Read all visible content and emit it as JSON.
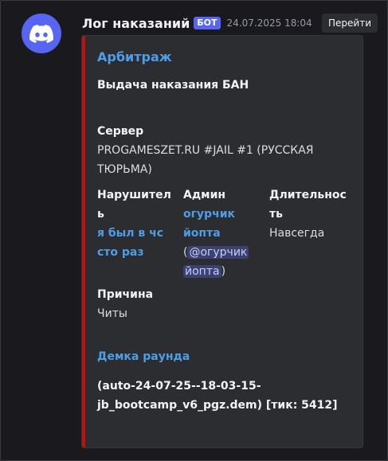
{
  "message": {
    "author": "Лог наказаний",
    "bot_tag": "БОТ",
    "timestamp": "24.07.2025 18:04",
    "go_button": "Перейти"
  },
  "embed": {
    "accent_color": "#c70c0c",
    "author": "Арбитраж",
    "title": "Выдача наказания БАН",
    "server_label": "Сервер",
    "server_line1": "PROGAMESZET.RU #JAIL #1 (РУССКАЯ",
    "server_line2": "ТЮРЬМА)",
    "offender_label_1": "Нарушител",
    "offender_label_2": "ь",
    "offender_line1": "я был в чс",
    "offender_line2": "сто раз",
    "admin_label": "Админ",
    "admin_line1": "огурчик",
    "admin_line2": "йопта",
    "admin_mention_1": "@огурчик",
    "admin_mention_2": "йопта",
    "duration_label_1": "Длительнос",
    "duration_label_2": "ть",
    "duration_value": "Навсегда",
    "reason_label": "Причина",
    "reason_value": "Читы",
    "demo_link": "Демка раунда",
    "demo_line1": "(auto-24-07-25--18-03-15-",
    "demo_line2": "jb_bootcamp_v6_pgz.dem) [тик: 5412]"
  }
}
